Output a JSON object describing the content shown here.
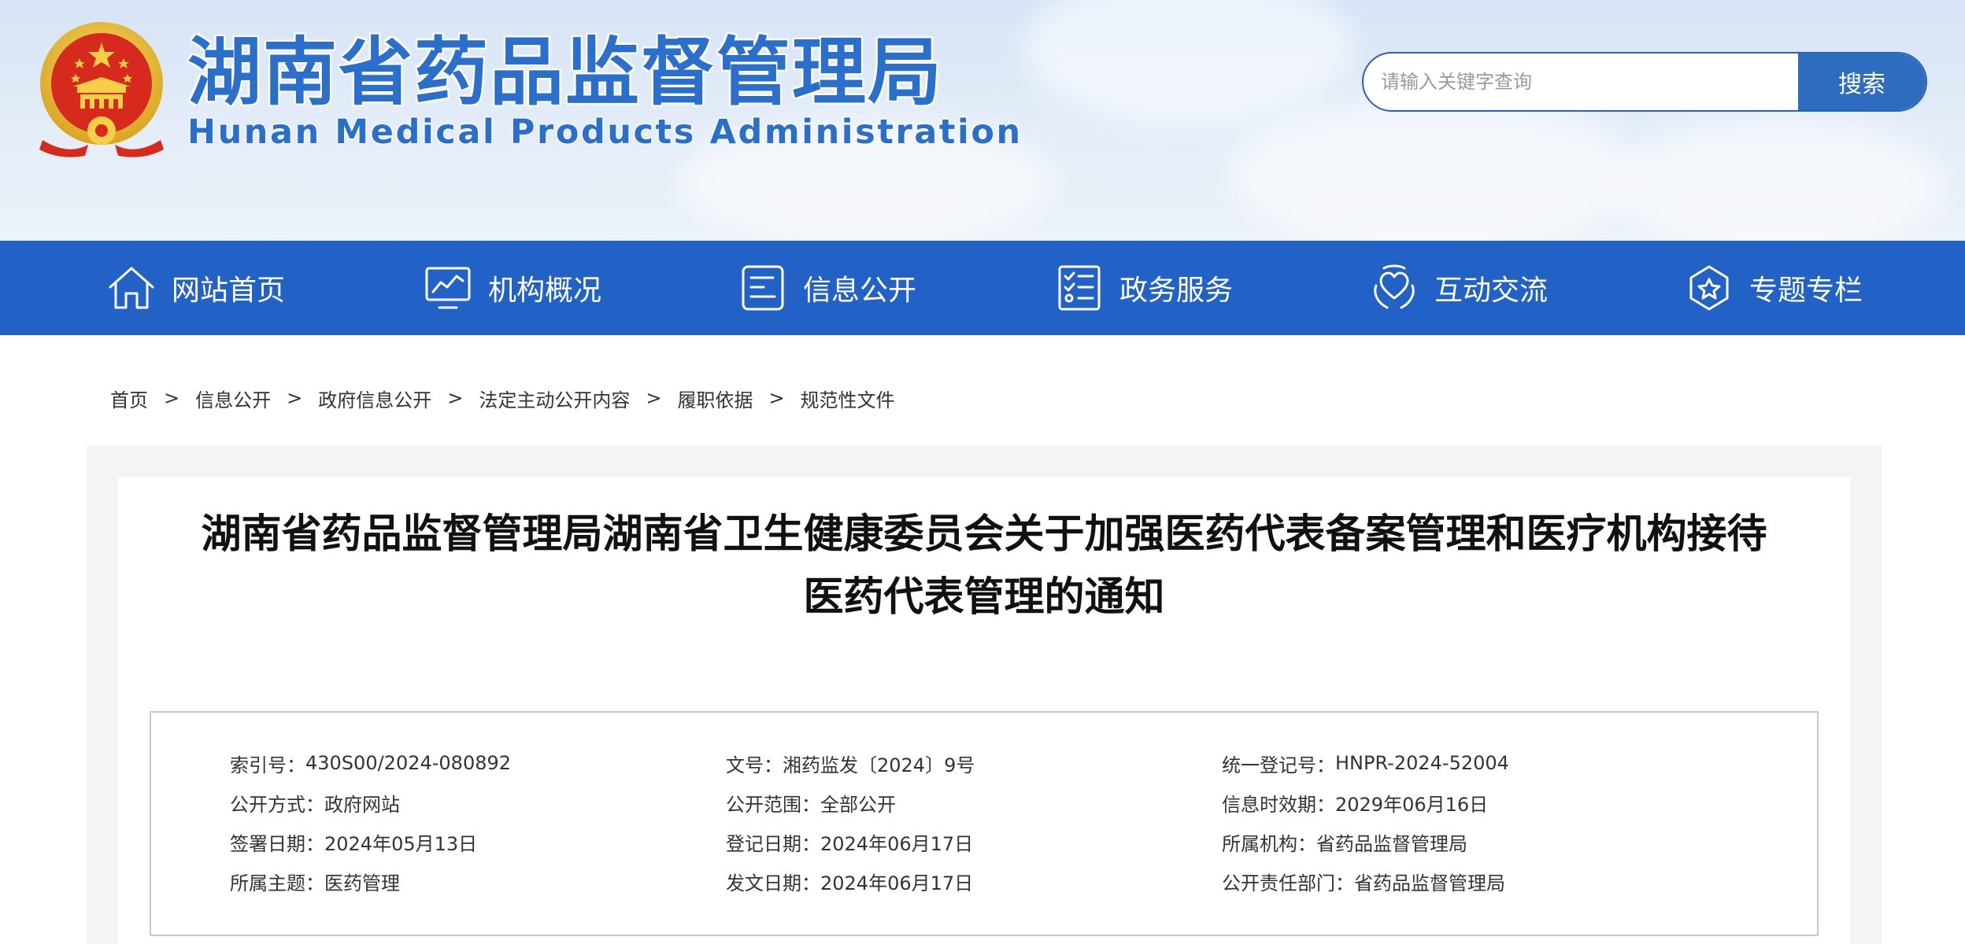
{
  "header": {
    "site_title": "湖南省药品监督管理局",
    "site_subtitle": "Hunan Medical Products Administration",
    "emblem_icon": "national-emblem-icon"
  },
  "search": {
    "placeholder": "请输入关键字查询",
    "button_label": "搜索"
  },
  "nav": {
    "items": [
      {
        "label": "网站首页",
        "icon": "home-icon"
      },
      {
        "label": "机构概况",
        "icon": "monitor-chart-icon"
      },
      {
        "label": "信息公开",
        "icon": "document-list-icon"
      },
      {
        "label": "政务服务",
        "icon": "checklist-icon"
      },
      {
        "label": "互动交流",
        "icon": "heart-hands-icon"
      },
      {
        "label": "专题专栏",
        "icon": "star-badge-icon"
      }
    ]
  },
  "breadcrumb": {
    "items": [
      "首页",
      "信息公开",
      "政府信息公开",
      "法定主动公开内容",
      "履职依据",
      "规范性文件"
    ],
    "separator": ">"
  },
  "article": {
    "title_line1": "湖南省药品监督管理局湖南省卫生健康委员会关于加强医药代表备案管理和医疗机构接待",
    "title_line2": "医药代表管理的通知"
  },
  "meta": {
    "col1": [
      {
        "key": "索引号：",
        "value": "430S00/2024-080892"
      },
      {
        "key": "公开方式：",
        "value": "政府网站"
      },
      {
        "key": "签署日期：",
        "value": "2024年05月13日"
      },
      {
        "key": "所属主题：",
        "value": "医药管理"
      }
    ],
    "col2": [
      {
        "key": "文号：",
        "value": "湘药监发〔2024〕9号"
      },
      {
        "key": "公开范围：",
        "value": "全部公开"
      },
      {
        "key": "登记日期：",
        "value": "2024年06月17日"
      },
      {
        "key": "发文日期：",
        "value": "2024年06月17日"
      }
    ],
    "col3": [
      {
        "key": "统一登记号：",
        "value": "HNPR-2024-52004"
      },
      {
        "key": "信息时效期：",
        "value": "2029年06月16日"
      },
      {
        "key": "所属机构：",
        "value": "省药品监督管理局"
      },
      {
        "key": "公开责任部门：",
        "value": "省药品监督管理局"
      }
    ]
  },
  "colors": {
    "brand_blue": "#2262c6",
    "title_blue": "#2a6fcc",
    "search_button": "#2e6cc0",
    "emblem_red": "#d62a1e",
    "emblem_gold": "#f3c43a"
  }
}
